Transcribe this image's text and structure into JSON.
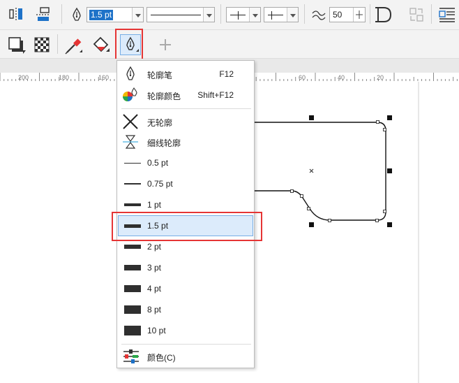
{
  "toolbar": {
    "outline_width_value": "1.5 pt",
    "corner_value": "50"
  },
  "ruler": {
    "labels": [
      "200",
      "180",
      "160",
      "60",
      "40",
      "20"
    ]
  },
  "menu": {
    "items": [
      {
        "label": "轮廓笔",
        "shortcut": "F12"
      },
      {
        "label": "轮廓颜色",
        "shortcut": "Shift+F12"
      },
      {
        "label": "无轮廓"
      },
      {
        "label": "细线轮廓"
      },
      {
        "label": "0.5 pt"
      },
      {
        "label": "0.75 pt"
      },
      {
        "label": "1 pt"
      },
      {
        "label": "1.5 pt",
        "selected": true
      },
      {
        "label": "2 pt"
      },
      {
        "label": "3 pt"
      },
      {
        "label": "4 pt"
      },
      {
        "label": "8 pt"
      },
      {
        "label": "10 pt"
      },
      {
        "label": "颜色(C)"
      }
    ]
  },
  "colors": {
    "highlight_fill": "#dcebfb",
    "highlight_border": "#78aee5",
    "annotation_red": "#e53535",
    "accent_blue": "#1e72c8"
  }
}
